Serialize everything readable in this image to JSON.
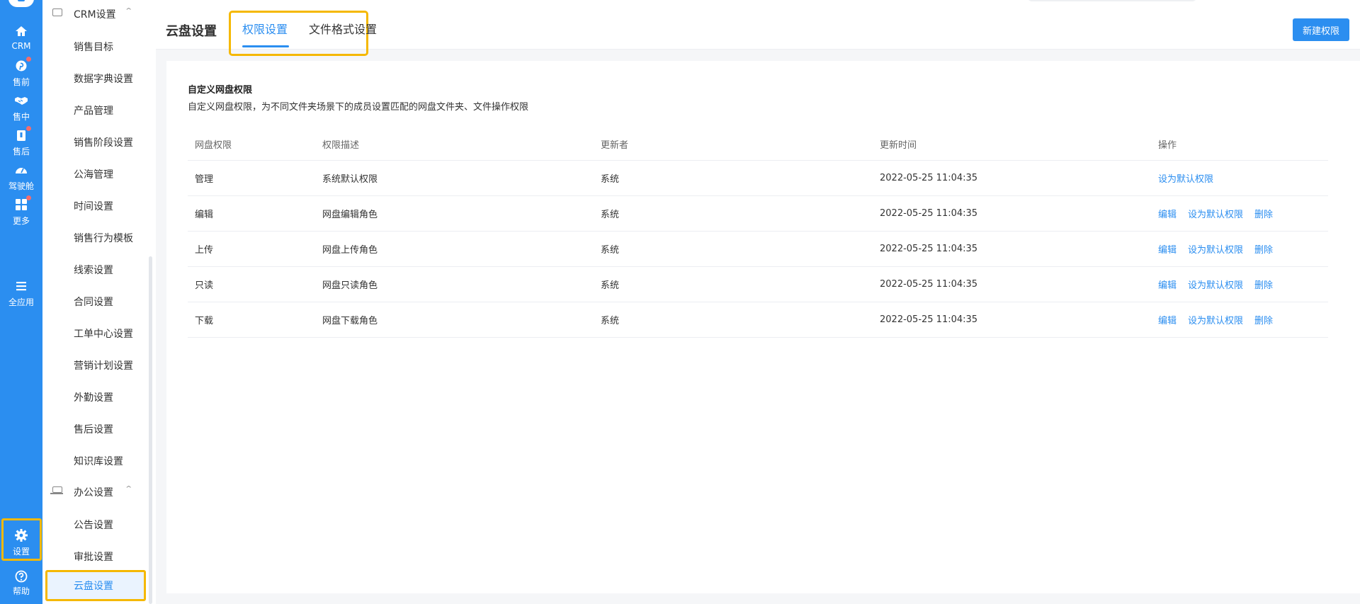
{
  "rail": {
    "items": [
      {
        "label": "CRM",
        "icon": "home-icon"
      },
      {
        "label": "售前",
        "icon": "pinterest-icon",
        "badge": true
      },
      {
        "label": "售中",
        "icon": "handshake-icon"
      },
      {
        "label": "售后",
        "icon": "clipboard-icon",
        "badge": true
      },
      {
        "label": "驾驶舱",
        "icon": "gauge-icon"
      },
      {
        "label": "更多",
        "icon": "grid-icon",
        "badge": true
      },
      {
        "label": "全应用",
        "icon": "menu-icon"
      }
    ],
    "settings_label": "设置",
    "help_label": "帮助"
  },
  "menu": {
    "group_crm": "CRM设置",
    "crm_items": [
      "销售目标",
      "数据字典设置",
      "产品管理",
      "销售阶段设置",
      "公海管理",
      "时间设置",
      "销售行为模板",
      "线索设置",
      "合同设置",
      "工单中心设置",
      "营销计划设置",
      "外勤设置",
      "售后设置",
      "知识库设置"
    ],
    "group_office": "办公设置",
    "office_items": [
      "公告设置",
      "审批设置",
      "云盘设置"
    ]
  },
  "header": {
    "title": "云盘设置",
    "tabs": [
      {
        "label": "权限设置",
        "active": true
      },
      {
        "label": "文件格式设置",
        "active": false
      }
    ],
    "new_button": "新建权限"
  },
  "section": {
    "title": "自定义网盘权限",
    "description": "自定义网盘权限，为不同文件夹场景下的成员设置匹配的网盘文件夹、文件操作权限"
  },
  "table": {
    "columns": [
      "网盘权限",
      "权限描述",
      "更新者",
      "更新时间",
      "操作"
    ],
    "rows": [
      {
        "name": "管理",
        "desc": "系统默认权限",
        "updater": "系统",
        "time": "2022-05-25 11:04:35",
        "actions": [
          "设为默认权限"
        ]
      },
      {
        "name": "编辑",
        "desc": "网盘编辑角色",
        "updater": "系统",
        "time": "2022-05-25 11:04:35",
        "actions": [
          "编辑",
          "设为默认权限",
          "删除"
        ]
      },
      {
        "name": "上传",
        "desc": "网盘上传角色",
        "updater": "系统",
        "time": "2022-05-25 11:04:35",
        "actions": [
          "编辑",
          "设为默认权限",
          "删除"
        ]
      },
      {
        "name": "只读",
        "desc": "网盘只读角色",
        "updater": "系统",
        "time": "2022-05-25 11:04:35",
        "actions": [
          "编辑",
          "设为默认权限",
          "删除"
        ]
      },
      {
        "name": "下载",
        "desc": "网盘下载角色",
        "updater": "系统",
        "time": "2022-05-25 11:04:35",
        "actions": [
          "编辑",
          "设为默认权限",
          "删除"
        ]
      }
    ]
  },
  "colors": {
    "accent": "#2b8ef0",
    "highlight": "#f5b800",
    "badge": "#f56c6c"
  }
}
